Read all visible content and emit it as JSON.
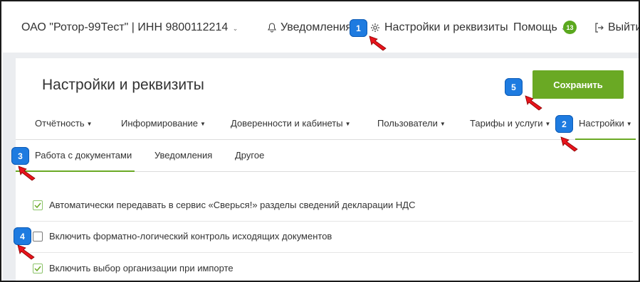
{
  "header": {
    "org_label": "ОАО \"Ротор-99Тест\" | ИНН 9800112214",
    "notifications_label": "Уведомления",
    "settings_label": "Настройки и реквизиты",
    "help_label": "Помощь",
    "help_badge": "13",
    "logout_label": "Выйти"
  },
  "page": {
    "title": "Настройки и реквизиты",
    "save_label": "Сохранить"
  },
  "main_tabs": [
    {
      "label": "Отчётность"
    },
    {
      "label": "Информирование"
    },
    {
      "label": "Доверенности и кабинеты"
    },
    {
      "label": "Пользователи"
    },
    {
      "label": "Тарифы и услуги"
    },
    {
      "label": "Настройки",
      "active": true
    }
  ],
  "sub_tabs": [
    {
      "label": "Работа с документами",
      "active": true
    },
    {
      "label": "Уведомления"
    },
    {
      "label": "Другое"
    }
  ],
  "options": [
    {
      "label": "Автоматически передавать в сервис «Сверься!» разделы сведений декларации НДС",
      "checked": true
    },
    {
      "label": "Включить форматно-логический контроль исходящих документов",
      "checked": false
    },
    {
      "label": "Включить выбор организации при импорте",
      "checked": true
    }
  ],
  "annotations": [
    "1",
    "2",
    "3",
    "4",
    "5"
  ],
  "colors": {
    "accent_green": "#6aa924",
    "badge_blue": "#1e7be0",
    "arrow_red": "#e8141c",
    "background_gray": "#ebedf0"
  }
}
